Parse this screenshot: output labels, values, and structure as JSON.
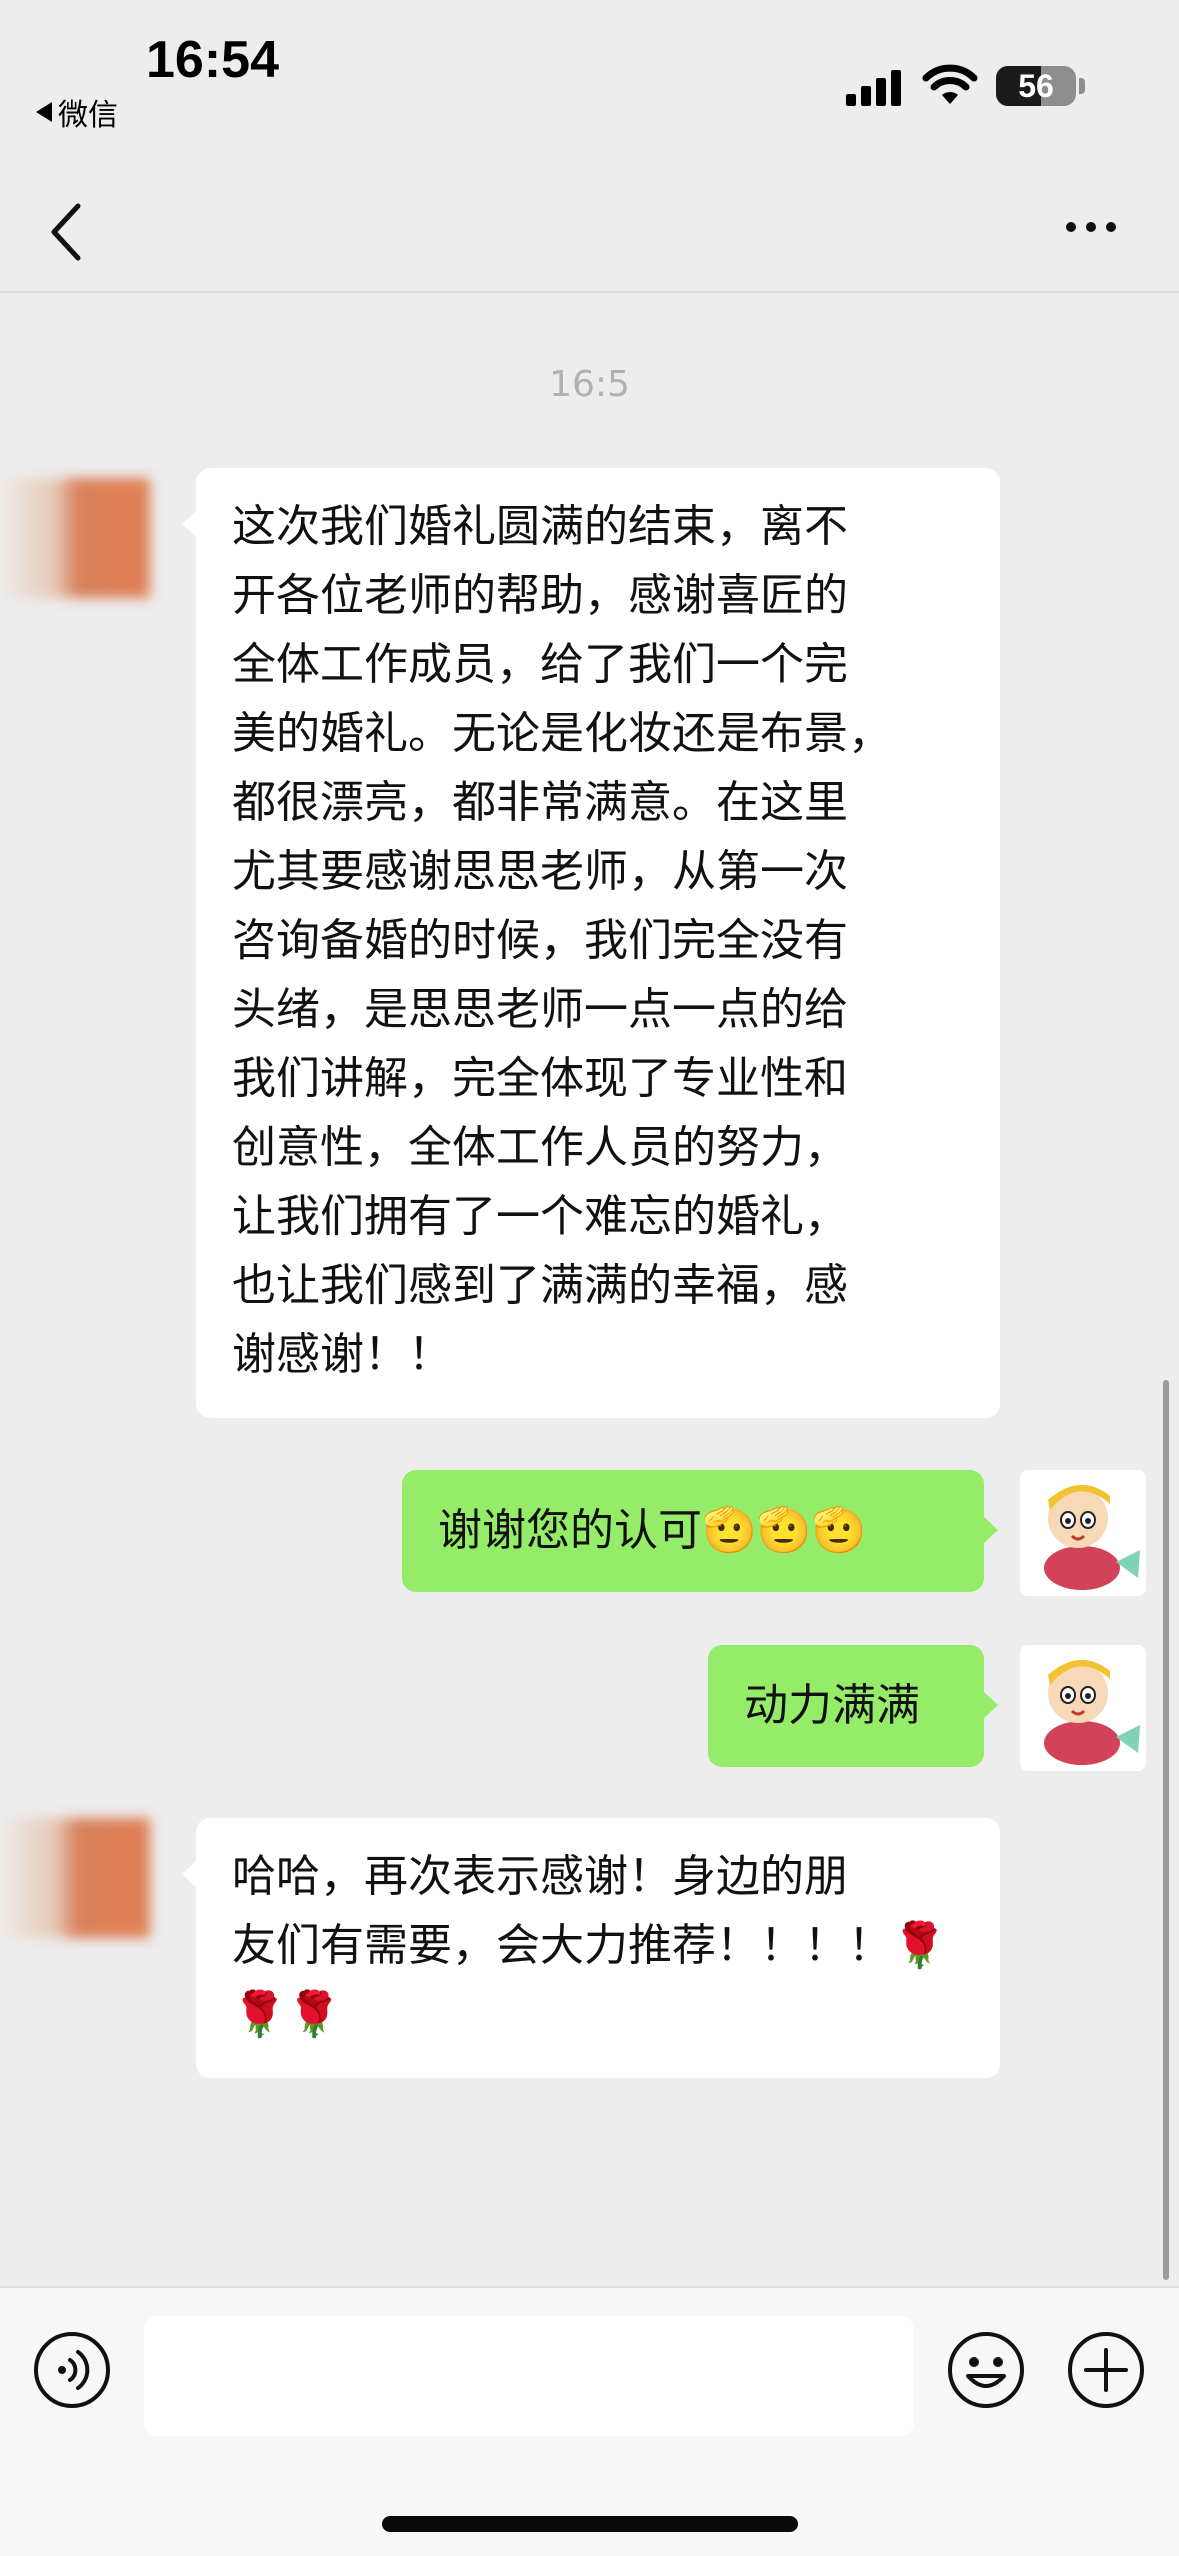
{
  "status_bar": {
    "time": "16:54",
    "back_app": "微信",
    "battery": "56",
    "battery_level": 0.56
  },
  "nav": {
    "back_icon": "chevron-left-icon",
    "more_icon": "more-dots-icon"
  },
  "chat": {
    "timestamp": "16:5",
    "messages": [
      {
        "side": "left",
        "text": "这次我们婚礼圆满的结束，离不\n开各位老师的帮助，感谢喜匠的\n全体工作成员，给了我们一个完\n美的婚礼。无论是化妆还是布景，\n都很漂亮，都非常满意。在这里\n尤其要感谢思思老师，从第一次\n咨询备婚的时候，我们完全没有\n头绪，是思思老师一点一点的给\n我们讲解，完全体现了专业性和\n创意性，全体工作人员的努力，\n让我们拥有了一个难忘的婚礼，\n也让我们感到了满满的幸福，感\n谢感谢！！"
      },
      {
        "side": "right",
        "text": "谢谢您的认可🫡🫡🫡"
      },
      {
        "side": "right",
        "text": "动力满满"
      },
      {
        "side": "left",
        "text": "哈哈，再次表示感谢！身边的朋\n友们有需要，会大力推荐！！！！🌹\n🌹🌹"
      }
    ]
  },
  "input_bar": {
    "placeholder": "",
    "voice_icon": "voice-icon",
    "emoji_icon": "emoji-icon",
    "plus_icon": "plus-icon"
  },
  "colors": {
    "background": "#ededed",
    "self_bubble": "#95ec69",
    "other_bubble": "#ffffff",
    "timestamp": "#b0b0b0"
  }
}
